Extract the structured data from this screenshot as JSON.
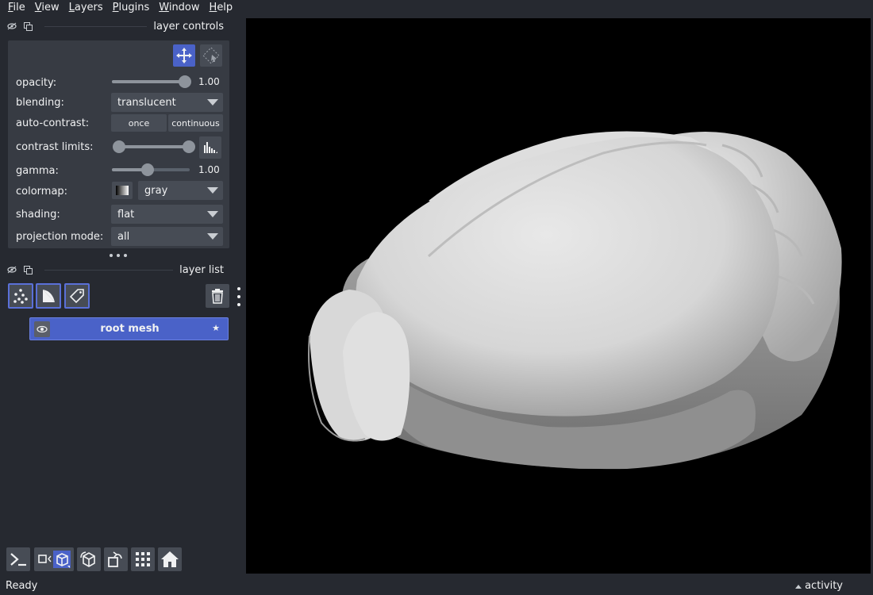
{
  "menu": [
    {
      "label": "File",
      "underline": "F",
      "rest": "ile"
    },
    {
      "label": "View",
      "underline": "V",
      "rest": "iew"
    },
    {
      "label": "Layers",
      "underline": "L",
      "rest": "ayers"
    },
    {
      "label": "Plugins",
      "underline": "P",
      "rest": "lugins"
    },
    {
      "label": "Window",
      "underline": "W",
      "rest": "indow"
    },
    {
      "label": "Help",
      "underline": "H",
      "rest": "elp"
    }
  ],
  "layer_controls": {
    "title": "layer controls",
    "opacity": {
      "label": "opacity:",
      "value": "1.00",
      "fraction": 1.0
    },
    "blending": {
      "label": "blending:",
      "value": "translucent"
    },
    "auto_contrast": {
      "label": "auto-contrast:",
      "once": "once",
      "continuous": "continuous"
    },
    "contrast_limits": {
      "label": "contrast limits:",
      "low": 0.0,
      "high": 1.0
    },
    "gamma": {
      "label": "gamma:",
      "value": "1.00",
      "fraction": 0.45
    },
    "colormap": {
      "label": "colormap:",
      "value": "gray"
    },
    "shading": {
      "label": "shading:",
      "value": "flat"
    },
    "projection_mode": {
      "label": "projection mode:",
      "value": "all"
    }
  },
  "layer_list": {
    "title": "layer list",
    "layers": [
      {
        "name": "root mesh",
        "visible": true
      }
    ]
  },
  "status": {
    "text": "Ready",
    "activity": "activity"
  },
  "colors": {
    "accent": "#4a62c8",
    "background": "#262930",
    "panel": "#373b43"
  }
}
